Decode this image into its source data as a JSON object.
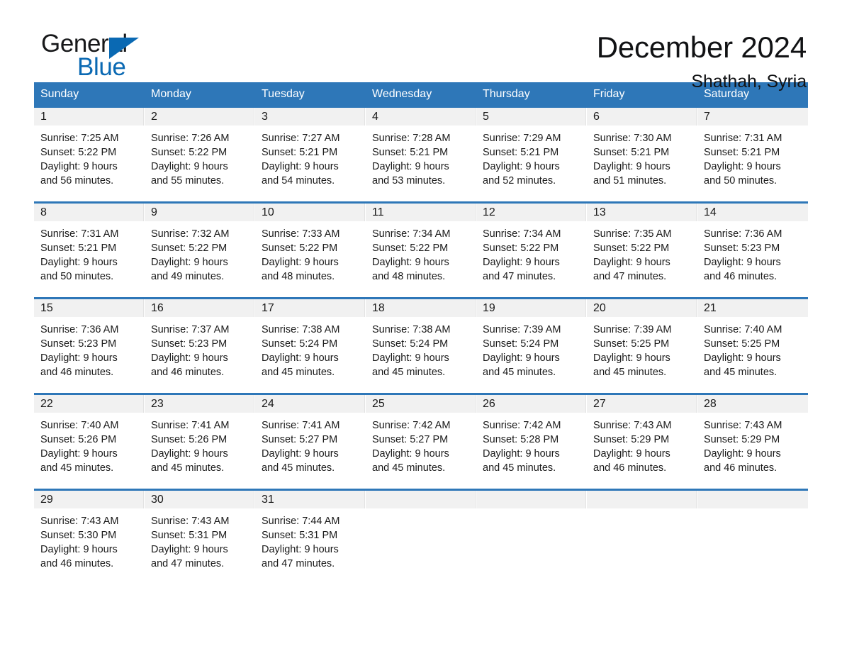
{
  "brand": {
    "name_part1": "General",
    "name_part2": "Blue",
    "triangle_color": "#0a69b3",
    "logo_icon": "triangle-icon"
  },
  "header": {
    "title": "December 2024",
    "location": "Shathah, Syria",
    "accent_color": "#2e77b8",
    "band_color": "#f1f1f1"
  },
  "weekdays": [
    "Sunday",
    "Monday",
    "Tuesday",
    "Wednesday",
    "Thursday",
    "Friday",
    "Saturday"
  ],
  "weeks": [
    [
      {
        "day": "1",
        "detail": "Sunrise: 7:25 AM\nSunset: 5:22 PM\nDaylight: 9 hours\nand 56 minutes."
      },
      {
        "day": "2",
        "detail": "Sunrise: 7:26 AM\nSunset: 5:22 PM\nDaylight: 9 hours\nand 55 minutes."
      },
      {
        "day": "3",
        "detail": "Sunrise: 7:27 AM\nSunset: 5:21 PM\nDaylight: 9 hours\nand 54 minutes."
      },
      {
        "day": "4",
        "detail": "Sunrise: 7:28 AM\nSunset: 5:21 PM\nDaylight: 9 hours\nand 53 minutes."
      },
      {
        "day": "5",
        "detail": "Sunrise: 7:29 AM\nSunset: 5:21 PM\nDaylight: 9 hours\nand 52 minutes."
      },
      {
        "day": "6",
        "detail": "Sunrise: 7:30 AM\nSunset: 5:21 PM\nDaylight: 9 hours\nand 51 minutes."
      },
      {
        "day": "7",
        "detail": "Sunrise: 7:31 AM\nSunset: 5:21 PM\nDaylight: 9 hours\nand 50 minutes."
      }
    ],
    [
      {
        "day": "8",
        "detail": "Sunrise: 7:31 AM\nSunset: 5:21 PM\nDaylight: 9 hours\nand 50 minutes."
      },
      {
        "day": "9",
        "detail": "Sunrise: 7:32 AM\nSunset: 5:22 PM\nDaylight: 9 hours\nand 49 minutes."
      },
      {
        "day": "10",
        "detail": "Sunrise: 7:33 AM\nSunset: 5:22 PM\nDaylight: 9 hours\nand 48 minutes."
      },
      {
        "day": "11",
        "detail": "Sunrise: 7:34 AM\nSunset: 5:22 PM\nDaylight: 9 hours\nand 48 minutes."
      },
      {
        "day": "12",
        "detail": "Sunrise: 7:34 AM\nSunset: 5:22 PM\nDaylight: 9 hours\nand 47 minutes."
      },
      {
        "day": "13",
        "detail": "Sunrise: 7:35 AM\nSunset: 5:22 PM\nDaylight: 9 hours\nand 47 minutes."
      },
      {
        "day": "14",
        "detail": "Sunrise: 7:36 AM\nSunset: 5:23 PM\nDaylight: 9 hours\nand 46 minutes."
      }
    ],
    [
      {
        "day": "15",
        "detail": "Sunrise: 7:36 AM\nSunset: 5:23 PM\nDaylight: 9 hours\nand 46 minutes."
      },
      {
        "day": "16",
        "detail": "Sunrise: 7:37 AM\nSunset: 5:23 PM\nDaylight: 9 hours\nand 46 minutes."
      },
      {
        "day": "17",
        "detail": "Sunrise: 7:38 AM\nSunset: 5:24 PM\nDaylight: 9 hours\nand 45 minutes."
      },
      {
        "day": "18",
        "detail": "Sunrise: 7:38 AM\nSunset: 5:24 PM\nDaylight: 9 hours\nand 45 minutes."
      },
      {
        "day": "19",
        "detail": "Sunrise: 7:39 AM\nSunset: 5:24 PM\nDaylight: 9 hours\nand 45 minutes."
      },
      {
        "day": "20",
        "detail": "Sunrise: 7:39 AM\nSunset: 5:25 PM\nDaylight: 9 hours\nand 45 minutes."
      },
      {
        "day": "21",
        "detail": "Sunrise: 7:40 AM\nSunset: 5:25 PM\nDaylight: 9 hours\nand 45 minutes."
      }
    ],
    [
      {
        "day": "22",
        "detail": "Sunrise: 7:40 AM\nSunset: 5:26 PM\nDaylight: 9 hours\nand 45 minutes."
      },
      {
        "day": "23",
        "detail": "Sunrise: 7:41 AM\nSunset: 5:26 PM\nDaylight: 9 hours\nand 45 minutes."
      },
      {
        "day": "24",
        "detail": "Sunrise: 7:41 AM\nSunset: 5:27 PM\nDaylight: 9 hours\nand 45 minutes."
      },
      {
        "day": "25",
        "detail": "Sunrise: 7:42 AM\nSunset: 5:27 PM\nDaylight: 9 hours\nand 45 minutes."
      },
      {
        "day": "26",
        "detail": "Sunrise: 7:42 AM\nSunset: 5:28 PM\nDaylight: 9 hours\nand 45 minutes."
      },
      {
        "day": "27",
        "detail": "Sunrise: 7:43 AM\nSunset: 5:29 PM\nDaylight: 9 hours\nand 46 minutes."
      },
      {
        "day": "28",
        "detail": "Sunrise: 7:43 AM\nSunset: 5:29 PM\nDaylight: 9 hours\nand 46 minutes."
      }
    ],
    [
      {
        "day": "29",
        "detail": "Sunrise: 7:43 AM\nSunset: 5:30 PM\nDaylight: 9 hours\nand 46 minutes."
      },
      {
        "day": "30",
        "detail": "Sunrise: 7:43 AM\nSunset: 5:31 PM\nDaylight: 9 hours\nand 47 minutes."
      },
      {
        "day": "31",
        "detail": "Sunrise: 7:44 AM\nSunset: 5:31 PM\nDaylight: 9 hours\nand 47 minutes."
      },
      {
        "day": "",
        "detail": ""
      },
      {
        "day": "",
        "detail": ""
      },
      {
        "day": "",
        "detail": ""
      },
      {
        "day": "",
        "detail": ""
      }
    ]
  ]
}
